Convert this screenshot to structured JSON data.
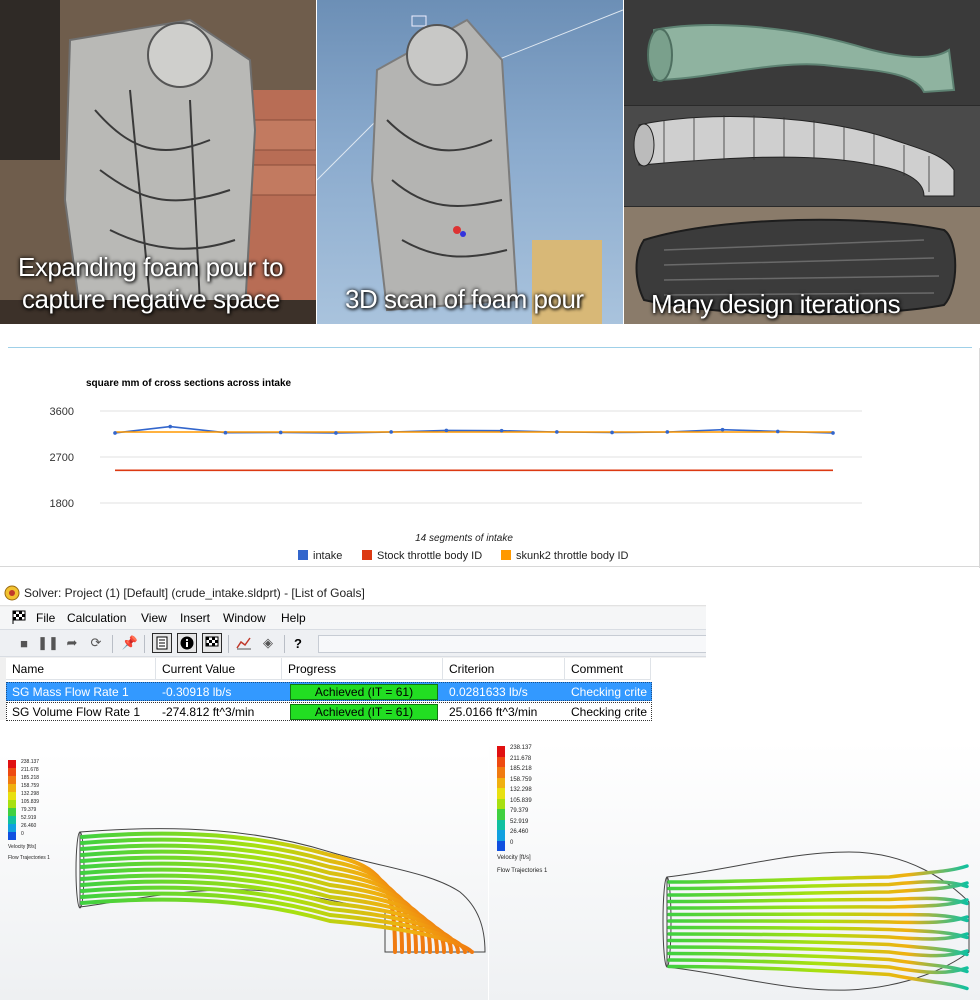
{
  "photos": {
    "foam": {
      "caption_line1": "Expanding foam pour to",
      "caption_line2": "capture negative space"
    },
    "scan": {
      "caption": "3D scan of foam pour"
    },
    "iterations": {
      "caption": "Many design iterations"
    }
  },
  "chart_data": {
    "type": "line",
    "title": "square mm of cross sections across intake",
    "xlabel": "14 segments of intake",
    "ylabel": "",
    "ylim": [
      1800,
      3600
    ],
    "yticks": [
      1800,
      2700,
      3600
    ],
    "grid": true,
    "legend_position": "bottom",
    "x": [
      1,
      2,
      3,
      4,
      5,
      6,
      7,
      8,
      9,
      10,
      11,
      12,
      13,
      14
    ],
    "series": [
      {
        "name": "intake",
        "color": "#3366cc",
        "values": [
          3170,
          3295,
          3175,
          3180,
          3170,
          3190,
          3220,
          3215,
          3190,
          3180,
          3190,
          3235,
          3200,
          3170
        ]
      },
      {
        "name": "Stock throttle body ID",
        "color": "#dc3912",
        "values": [
          2440,
          2440,
          2440,
          2440,
          2440,
          2440,
          2440,
          2440,
          2440,
          2440,
          2440,
          2440,
          2440,
          2440
        ]
      },
      {
        "name": "skunk2 throttle body ID",
        "color": "#ff9900",
        "values": [
          3190,
          3190,
          3190,
          3190,
          3190,
          3190,
          3190,
          3190,
          3190,
          3190,
          3190,
          3190,
          3190,
          3190
        ]
      }
    ]
  },
  "solver": {
    "title": "Solver: Project (1) [Default] (crude_intake.sldprt) - [List of Goals]",
    "menu": [
      "File",
      "Calculation",
      "View",
      "Insert",
      "Window",
      "Help"
    ],
    "toolbar_icons": [
      "stop-icon",
      "pause-icon",
      "insert-icon",
      "refresh-icon",
      "pin-icon",
      "document-icon",
      "info-icon",
      "goals-flag-icon",
      "plot-icon",
      "settings-icon",
      "help-icon"
    ],
    "columns": [
      "Name",
      "Current Value",
      "Progress",
      "Criterion",
      "Comment"
    ],
    "rows": [
      {
        "name": "SG Mass Flow Rate 1",
        "current_value": "-0.30918 lb/s",
        "progress": "Achieved (IT = 61)",
        "progress_fraction": 1.0,
        "criterion": "0.0281633 lb/s",
        "comment": "Checking crite",
        "selected": true
      },
      {
        "name": "SG Volume Flow Rate 1",
        "current_value": "-274.812 ft^3/min",
        "progress": "Achieved (IT = 61)",
        "progress_fraction": 1.0,
        "criterion": "25.0166 ft^3/min",
        "comment": "Checking crite",
        "selected": false
      }
    ]
  },
  "cfd": {
    "legend_values": [
      "238.137",
      "211.678",
      "185.218",
      "158.759",
      "132.298",
      "105.839",
      "79.379",
      "52.919",
      "26.460",
      "0"
    ],
    "legend_colors": [
      "#e01010",
      "#ee4a10",
      "#f07a10",
      "#f0b010",
      "#e8e010",
      "#a8e010",
      "#40d040",
      "#10c0a0",
      "#10a0e0",
      "#1050e0"
    ],
    "legend_unit": "Velocity [ft/s]",
    "legend_caption": "Flow Trajectories 1"
  }
}
